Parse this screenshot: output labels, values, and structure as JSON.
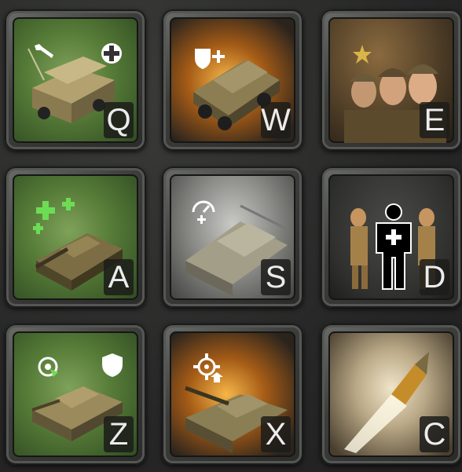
{
  "abilities": [
    {
      "hotkey": "Q",
      "icon": "supply-truck-repair-icon",
      "badge": "wrench-icon",
      "badge2": "medic-cross-icon"
    },
    {
      "hotkey": "W",
      "icon": "halftrack-icon",
      "badge": "armor-upgrade-icon"
    },
    {
      "hotkey": "E",
      "icon": "elite-squad-icon",
      "badge": "star-icon"
    },
    {
      "hotkey": "A",
      "icon": "assault-gun-heal-icon",
      "badge": "heal-crosses-icon"
    },
    {
      "hotkey": "S",
      "icon": "armored-car-speed-icon",
      "badge": "speed-gauge-icon"
    },
    {
      "hotkey": "D",
      "icon": "infantry-medic-icon",
      "badge": "medic-silhouette-icon"
    },
    {
      "hotkey": "Z",
      "icon": "light-tank-defensive-icon",
      "badge": "shield-icon",
      "badge2": "rotate-icon"
    },
    {
      "hotkey": "X",
      "icon": "tank-destroyer-targeting-icon",
      "badge": "crosshair-icon"
    },
    {
      "hotkey": "C",
      "icon": "tracer-shell-icon"
    }
  ]
}
